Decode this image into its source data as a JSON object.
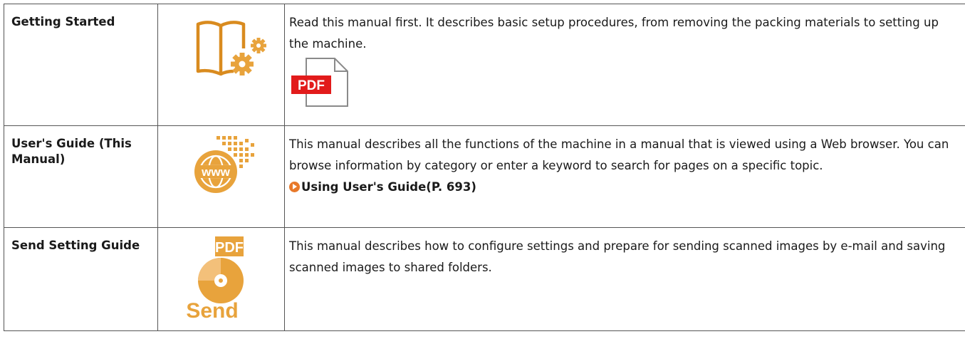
{
  "manuals": [
    {
      "name": "Getting Started",
      "icon": "book-gear-icon",
      "description": "Read this manual first. It describes basic setup procedures, from removing the packing materials to setting up the machine.",
      "file_badge": "PDF",
      "file_icon": "pdf-file-icon"
    },
    {
      "name": "User's Guide (This Manual)",
      "icon": "www-globe-icon",
      "description": "This manual describes all the functions of the machine in a manual that is viewed using a Web browser. You can browse information by category or enter a keyword to search for pages on a specific topic.",
      "link": "Using User's Guide(P. 693)"
    },
    {
      "name": "Send Setting Guide",
      "icon": "send-pdf-icon",
      "description": "This manual describes how to configure settings and prepare for sending scanned images by e-mail and saving scanned images to shared folders.",
      "icon_badge": "PDF",
      "icon_label": "Send"
    }
  ],
  "colors": {
    "accent": "#e8a33c",
    "accent_dark": "#d98b1f",
    "pdf_red": "#e21b1b",
    "border": "#555555",
    "link_arrow": "#e8792a"
  }
}
